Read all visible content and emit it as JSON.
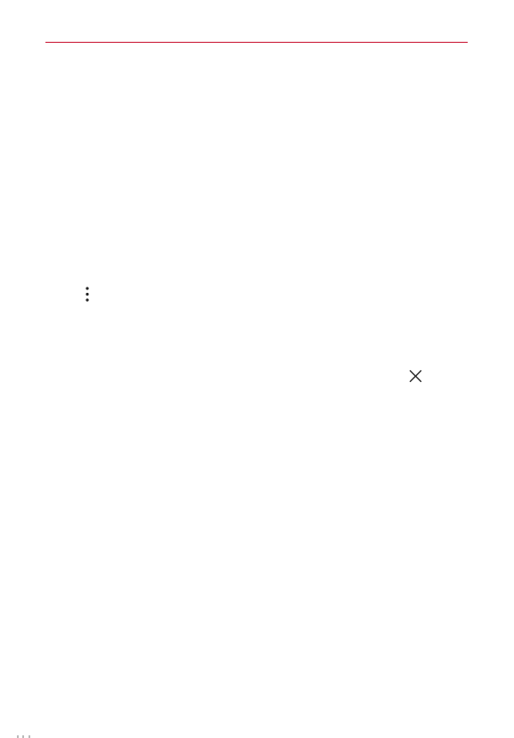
{
  "colors": {
    "accent_rule": "#c8102e",
    "icon_stroke": "#222222",
    "background": "#ffffff"
  },
  "icons": {
    "overflow_menu": "more-vertical-icon",
    "close": "close-icon"
  }
}
